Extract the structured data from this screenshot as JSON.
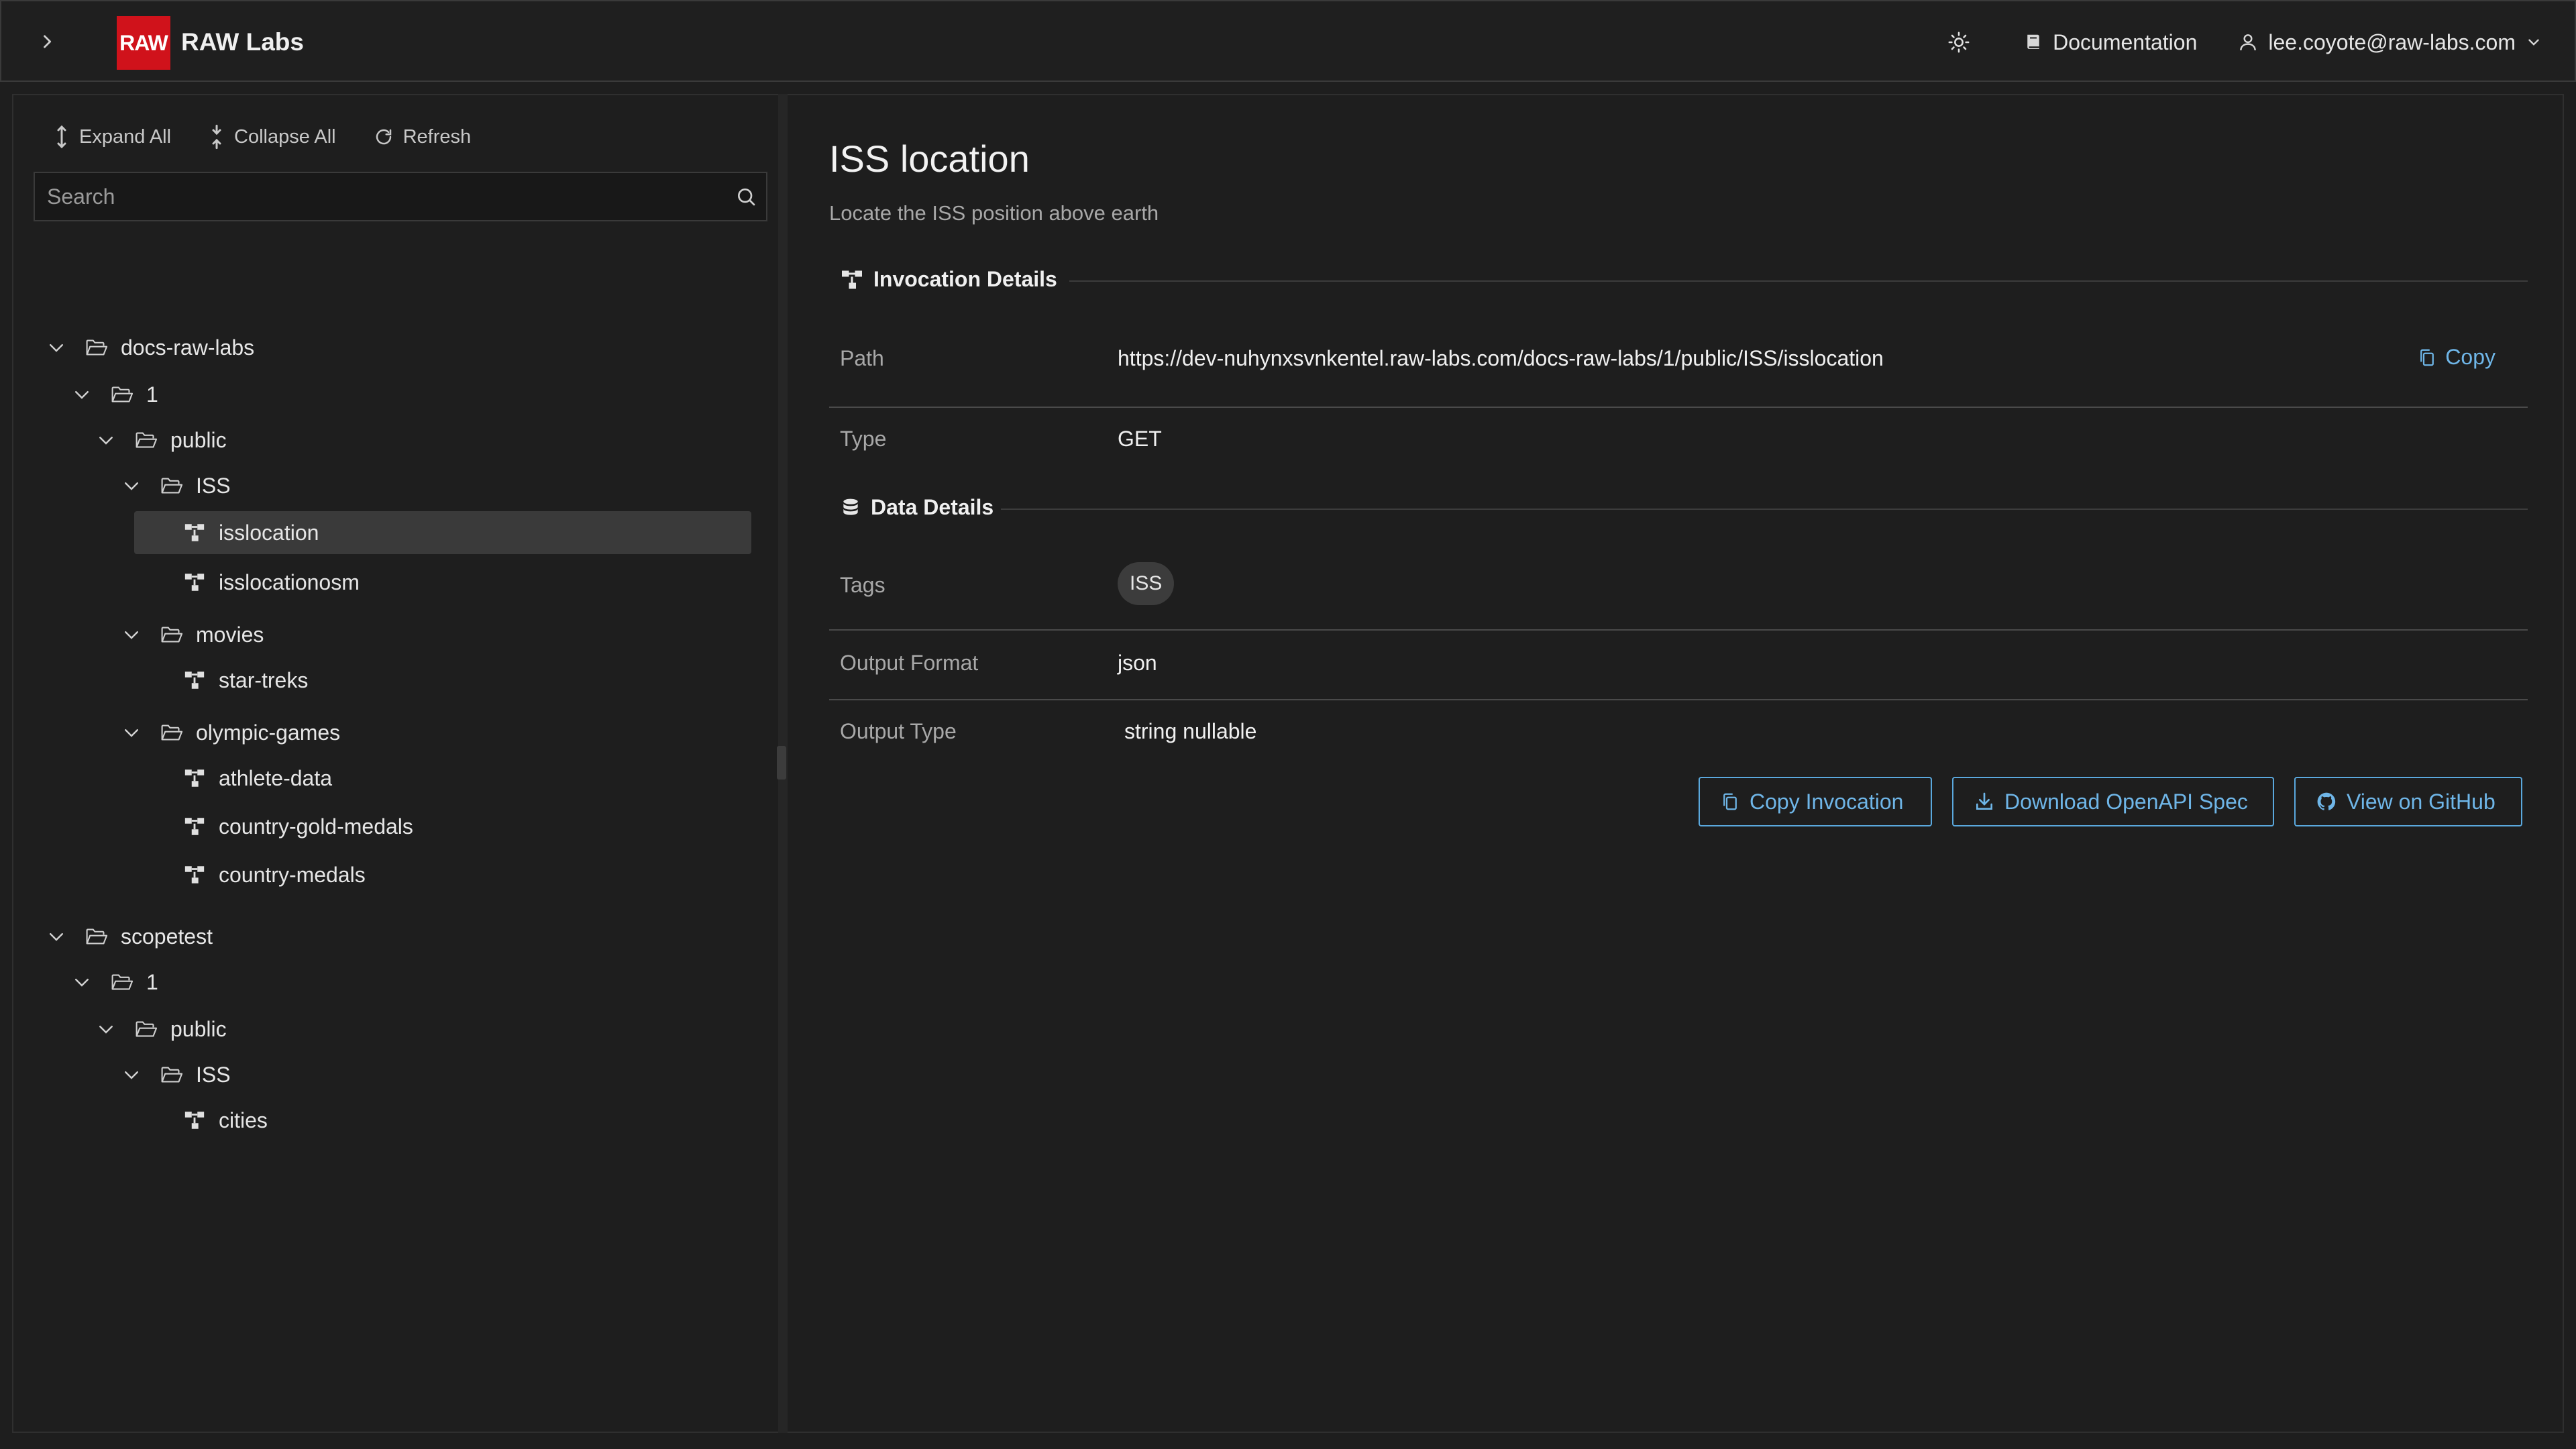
{
  "header": {
    "brand_logo": "RAW",
    "brand_name": "RAW Labs",
    "documentation_label": "Documentation",
    "user_email": "lee.coyote@raw-labs.com"
  },
  "sidebar": {
    "toolbar": {
      "expand_all": "Expand All",
      "collapse_all": "Collapse All",
      "refresh": "Refresh"
    },
    "search": {
      "placeholder": "Search",
      "value": ""
    },
    "tree": [
      {
        "label": "docs-raw-labs",
        "kind": "folder",
        "level": 0,
        "expanded": true
      },
      {
        "label": "1",
        "kind": "folder",
        "level": 1,
        "expanded": true
      },
      {
        "label": "public",
        "kind": "folder",
        "level": 2,
        "expanded": true
      },
      {
        "label": "ISS",
        "kind": "folder",
        "level": 3,
        "expanded": true
      },
      {
        "label": "isslocation",
        "kind": "endpoint",
        "level": 4,
        "selected": true
      },
      {
        "label": "isslocationosm",
        "kind": "endpoint",
        "level": 4
      },
      {
        "label": "movies",
        "kind": "folder",
        "level": 3,
        "expanded": true
      },
      {
        "label": "star-treks",
        "kind": "endpoint",
        "level": 4
      },
      {
        "label": "olympic-games",
        "kind": "folder",
        "level": 3,
        "expanded": true
      },
      {
        "label": "athlete-data",
        "kind": "endpoint",
        "level": 4
      },
      {
        "label": "country-gold-medals",
        "kind": "endpoint",
        "level": 4
      },
      {
        "label": "country-medals",
        "kind": "endpoint",
        "level": 4
      },
      {
        "label": "scopetest",
        "kind": "folder",
        "level": 0,
        "expanded": true
      },
      {
        "label": "1",
        "kind": "folder",
        "level": 1,
        "expanded": true
      },
      {
        "label": "public",
        "kind": "folder",
        "level": 2,
        "expanded": true
      },
      {
        "label": "ISS",
        "kind": "folder",
        "level": 3,
        "expanded": true
      },
      {
        "label": "cities",
        "kind": "endpoint",
        "level": 4
      }
    ]
  },
  "main": {
    "title": "ISS location",
    "description": "Locate the ISS position above earth",
    "invocation": {
      "heading": "Invocation Details",
      "path_label": "Path",
      "path_value": "https://dev-nuhynxsvnkentel.raw-labs.com/docs-raw-labs/1/public/ISS/isslocation",
      "copy_label": "Copy",
      "type_label": "Type",
      "type_value": "GET"
    },
    "data": {
      "heading": "Data Details",
      "tags_label": "Tags",
      "tags": [
        "ISS"
      ],
      "output_format_label": "Output Format",
      "output_format_value": "json",
      "output_type_label": "Output Type",
      "output_type_value": "string nullable"
    },
    "actions": {
      "copy_invocation": "Copy Invocation",
      "download_openapi": "Download OpenAPI Spec",
      "view_github": "View on GitHub"
    }
  },
  "colors": {
    "brand_red": "#d0121b",
    "accent_blue": "#6fb6e8",
    "background": "#1e1e1e",
    "selected_row": "#3a3a3a"
  }
}
